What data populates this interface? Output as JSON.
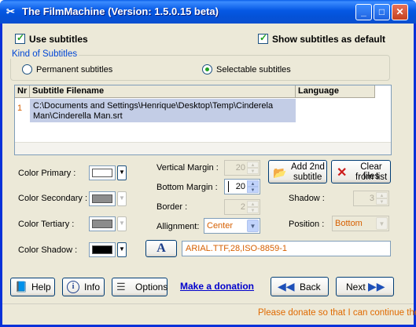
{
  "window": {
    "title": "The FilmMachine  (Version: 1.5.0.15 beta)"
  },
  "options": {
    "use_subtitles": "Use subtitles",
    "show_default": "Show subtitles as default"
  },
  "kind": {
    "title": "Kind of Subtitles",
    "permanent": "Permanent subtitles",
    "selectable": "Selectable subtitles",
    "selected": "selectable"
  },
  "table": {
    "headers": [
      "Nr",
      "Subtitle Filename",
      "Language"
    ],
    "rows": [
      {
        "nr": "1",
        "filename_line1": "C:\\Documents and Settings\\Henrique\\Desktop\\Temp\\Cinderela",
        "filename_line2": "Man\\Cinderella Man.srt",
        "language": ""
      }
    ]
  },
  "colors": {
    "primary_label": "Color Primary :",
    "secondary_label": "Color Secondary :",
    "tertiary_label": "Color Tertiary :",
    "shadow_label": "Color Shadow :",
    "primary": "#ffffff",
    "secondary": "#8c8c8c",
    "tertiary": "#8c8c8c",
    "shadow": "#000000"
  },
  "margins": {
    "vertical_label": "Vertical Margin :",
    "vertical_value": "20",
    "bottom_label": "Bottom Margin :",
    "bottom_value": "20",
    "border_label": "Border :",
    "border_value": "2",
    "alignment_label": "Allignment:",
    "alignment_value": "Center",
    "shadow_label": "Shadow :",
    "shadow_value": "3",
    "position_label": "Position :",
    "position_value": "Bottom"
  },
  "buttons": {
    "add_line1": "Add 2nd",
    "add_line2": "subtitle",
    "clear_line1": "Clear files",
    "clear_line2": "from list",
    "font_letter": "A",
    "font_value": "ARIAL.TTF,28,ISO-8859-1",
    "help": "Help",
    "info": "Info",
    "options": "Options",
    "donation": "Make a donation",
    "back": "Back",
    "next": "Next"
  },
  "status": {
    "text": "Please donate so that I can continue the"
  }
}
